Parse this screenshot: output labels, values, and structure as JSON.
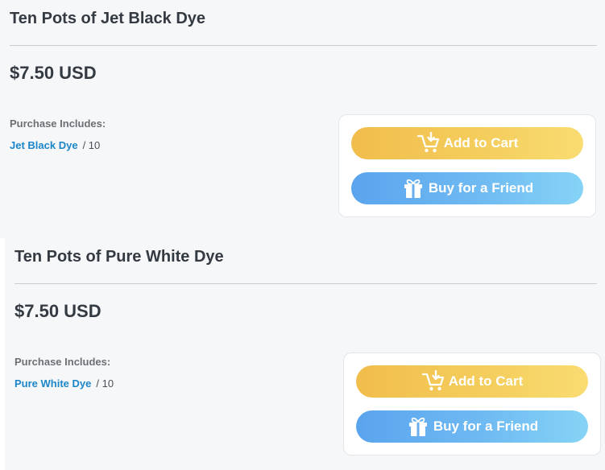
{
  "products": [
    {
      "title": "Ten Pots of Jet Black Dye",
      "price": "$7.50 USD",
      "includes_label": "Purchase Includes:",
      "item_name": "Jet Black Dye",
      "item_qty": "/ 10",
      "cart_label": "Add to Cart",
      "gift_label": "Buy for a Friend",
      "cart_icon": "cart-download-icon",
      "gift_icon": "gift-box-icon"
    },
    {
      "title": "Ten Pots of Pure White Dye",
      "price": "$7.50 USD",
      "includes_label": "Purchase Includes:",
      "item_name": "Pure White Dye",
      "item_qty": "/ 10",
      "cart_label": "Add to Cart",
      "gift_label": "Buy for a Friend",
      "cart_icon": "cart-download-icon",
      "gift_icon": "gift-box-icon"
    }
  ],
  "colors": {
    "cart_gradient": [
      "#f1bd4c",
      "#f9dc72"
    ],
    "gift_gradient": [
      "#5aa4ee",
      "#86d3f7"
    ],
    "link": "#1a86c7",
    "text": "#333a42"
  }
}
